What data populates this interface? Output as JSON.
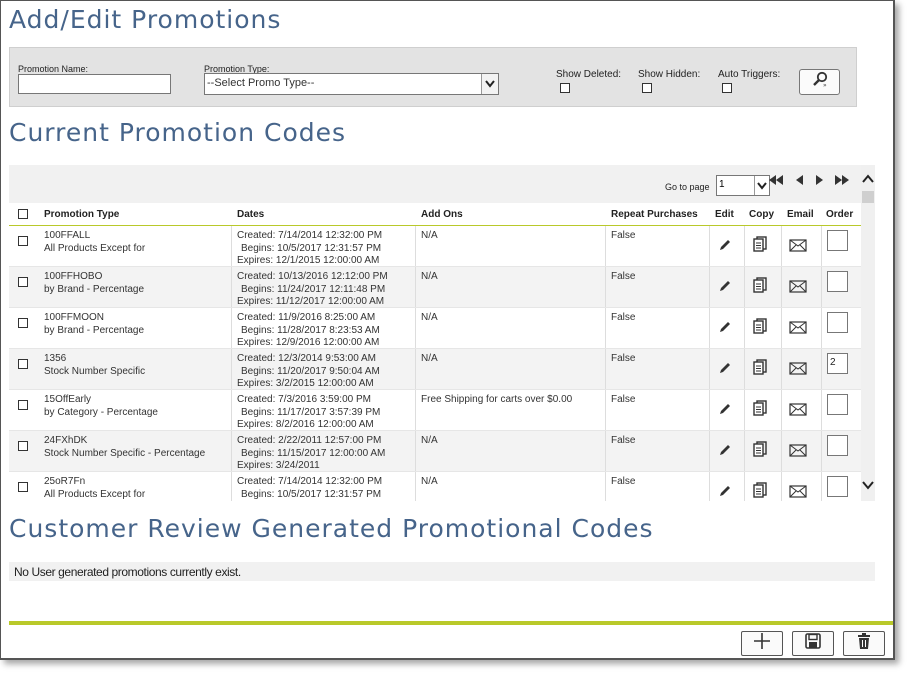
{
  "page_title": "Add/Edit Promotions",
  "filters": {
    "promotion_name_label": "Promotion Name:",
    "promotion_name_value": "",
    "promotion_type_label": "Promotion Type:",
    "promotion_type_value": "--Select Promo Type--",
    "show_deleted_label": "Show Deleted:",
    "show_hidden_label": "Show Hidden:",
    "auto_triggers_label": "Auto Triggers:",
    "show_deleted_checked": false,
    "show_hidden_checked": false,
    "auto_triggers_checked": false,
    "search_icon": "search-icon"
  },
  "current_codes": {
    "title": "Current Promotion Codes",
    "pager": {
      "label": "Go to page",
      "page_value": "1",
      "icons": [
        "first-page-icon",
        "previous-page-icon",
        "next-page-icon",
        "last-page-icon"
      ]
    },
    "columns": {
      "promotion_type": "Promotion Type",
      "dates": "Dates",
      "add_ons": "Add Ons",
      "repeat_purchases": "Repeat Purchases",
      "edit": "Edit",
      "copy": "Copy",
      "email": "Email",
      "order": "Order"
    },
    "rows": [
      {
        "code": "100FFALL",
        "type": "All Products Except for",
        "created": "Created: 7/14/2014 12:32:00 PM",
        "begins": "Begins: 10/5/2017 12:31:57 PM",
        "expires": "Expires: 12/1/2015 12:00:00 AM",
        "add_ons": "N/A",
        "repeat": "False",
        "order": ""
      },
      {
        "code": "100FFHOBO",
        "type": "by Brand - Percentage",
        "created": "Created: 10/13/2016 12:12:00 PM",
        "begins": "Begins: 11/24/2017 12:11:48 PM",
        "expires": "Expires: 11/12/2017 12:00:00 AM",
        "add_ons": "N/A",
        "repeat": "False",
        "order": ""
      },
      {
        "code": "100FFMOON",
        "type": "by Brand - Percentage",
        "created": "Created: 11/9/2016 8:25:00 AM",
        "begins": "Begins: 11/28/2017 8:23:53 AM",
        "expires": "Expires: 12/9/2016 12:00:00 AM",
        "add_ons": "N/A",
        "repeat": "False",
        "order": ""
      },
      {
        "code": "1356",
        "type": "Stock Number Specific",
        "created": "Created: 12/3/2014 9:53:00 AM",
        "begins": "Begins: 11/20/2017 9:50:04 AM",
        "expires": "Expires: 3/2/2015 12:00:00 AM",
        "add_ons": "N/A",
        "repeat": "False",
        "order": "2"
      },
      {
        "code": "15OffEarly",
        "type": "by Category - Percentage",
        "created": "Created: 7/3/2016 3:59:00 PM",
        "begins": "Begins: 11/17/2017 3:57:39 PM",
        "expires": "Expires: 8/2/2016 12:00:00 AM",
        "add_ons": "Free Shipping for carts over $0.00",
        "repeat": "False",
        "order": ""
      },
      {
        "code": "24FXhDK",
        "type": "Stock Number Specific - Percentage",
        "created": "Created: 2/22/2011 12:57:00 PM",
        "begins": "Begins: 11/15/2017 12:00:00 AM",
        "expires": "Expires: 3/24/2011",
        "add_ons": "N/A",
        "repeat": "False",
        "order": ""
      },
      {
        "code": "25oR7Fn",
        "type": "All Products Except for",
        "created": "Created: 7/14/2014 12:32:00 PM",
        "begins": "Begins: 10/5/2017 12:31:57 PM",
        "expires": "",
        "add_ons": "N/A",
        "repeat": "False",
        "order": ""
      }
    ]
  },
  "customer_review": {
    "title": "Customer Review Generated Promotional Codes",
    "empty_message": "No User generated promotions currently exist."
  },
  "footer_buttons": {
    "add_icon": "plus-icon",
    "save_icon": "save-icon",
    "delete_icon": "trash-icon"
  },
  "colors": {
    "heading": "#46648a",
    "accent_line": "#b9c92a",
    "filter_bg": "#e3e3e3",
    "row_alt_bg": "#f3f3f3"
  }
}
